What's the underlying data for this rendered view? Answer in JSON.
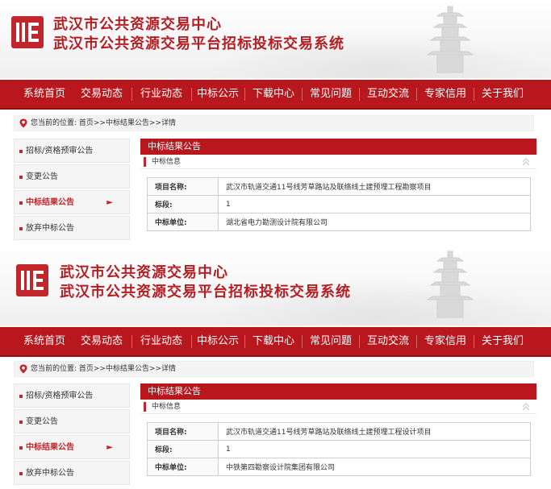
{
  "header": {
    "title_line1": "武汉市公共资源交易中心",
    "title_line2": "武汉市公共资源交易平台招标投标交易系统"
  },
  "nav": {
    "items": [
      "系统首页",
      "交易动态",
      "行业动态",
      "中标公示",
      "下载中心",
      "常见问题",
      "互动交流",
      "专家信用",
      "关于我们"
    ]
  },
  "breadcrumb": {
    "text": "您当前的位置: 首页>>中标结果公告>>详情"
  },
  "sidebar": {
    "items": [
      "招标/资格预审公告",
      "变更公告",
      "中标结果公告",
      "放弃中标公告"
    ],
    "active_arrow": "►"
  },
  "panel": {
    "title": "中标结果公告",
    "section": "中标信息",
    "collapse_glyph": "︽"
  },
  "shots": [
    {
      "rows": [
        {
          "key": "项目名称:",
          "value": "武汉市轨道交通11号线芳草路站及联络线土建预埋工程勘察项目"
        },
        {
          "key": "标段:",
          "value": "1"
        },
        {
          "key": "中标单位:",
          "value": "湖北省电力勘测设计院有限公司"
        }
      ]
    },
    {
      "rows": [
        {
          "key": "项目名称:",
          "value": "武汉市轨道交通11号线芳草路站及联络线土建预埋工程设计项目"
        },
        {
          "key": "标段:",
          "value": "1"
        },
        {
          "key": "中标单位:",
          "value": "中铁第四勘察设计院集团有限公司"
        }
      ]
    }
  ],
  "colors": {
    "brand_red": "#b8181d",
    "accent_red": "#c0262b"
  }
}
